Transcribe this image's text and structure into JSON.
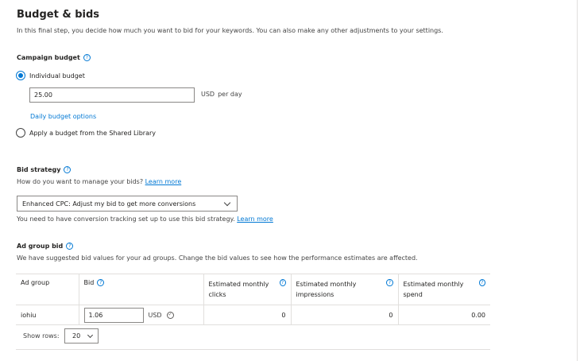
{
  "page": {
    "title": "Budget & bids",
    "subtitle": "In this final step, you decide how much you want to bid for your keywords. You can also make any other adjustments to your settings."
  },
  "campaign_budget": {
    "heading": "Campaign budget",
    "help_icon": "?",
    "options": [
      {
        "label": "Individual budget",
        "selected": true
      },
      {
        "label": "Apply a budget from the Shared Library",
        "selected": false
      }
    ],
    "amount": "25.00",
    "currency": "USD",
    "period": "per day",
    "options_link": "Daily budget options"
  },
  "bid_strategy": {
    "heading": "Bid strategy",
    "help_icon": "?",
    "question": "How do you want to manage your bids?",
    "learn_more": "Learn more",
    "selected": "Enhanced CPC: Adjust my bid to get more conversions",
    "note": "You need to have conversion tracking set up to use this bid strategy.",
    "note_link": "Learn more"
  },
  "ad_group_bid": {
    "heading": "Ad group bid",
    "help_icon": "?",
    "description": "We have suggested bid values for your ad groups. Change the bid values to see how the performance estimates are affected.",
    "columns": {
      "ad_group": "Ad group",
      "bid": "Bid",
      "clicks": "Estimated monthly clicks",
      "impressions": "Estimated monthly impressions",
      "spend": "Estimated monthly spend"
    },
    "rows": [
      {
        "ad_group": "iohiu",
        "bid": "1.06",
        "currency": "USD",
        "clicks": "0",
        "impressions": "0",
        "spend": "0.00"
      }
    ],
    "show_rows_label": "Show rows:",
    "show_rows_value": "20"
  },
  "icons": {
    "help": "question-circle-icon",
    "check": "check-circle-icon",
    "dropdown": "chevron-down-icon"
  },
  "colors": {
    "accent": "#0078d4",
    "text": "#252423",
    "border": "#8a8886",
    "divider": "#e1dfdd"
  }
}
